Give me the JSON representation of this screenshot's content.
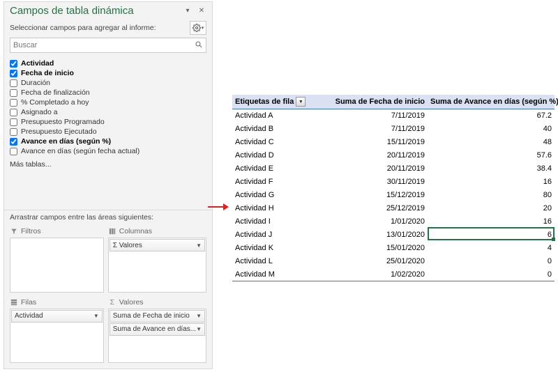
{
  "panel": {
    "title": "Campos de tabla dinámica",
    "subtitle": "Seleccionar campos para agregar al informe:",
    "search_placeholder": "Buscar",
    "more_tables": "Más tablas...",
    "drag_label": "Arrastrar campos entre las áreas siguientes:"
  },
  "fields": [
    {
      "label": "Actividad",
      "checked": true
    },
    {
      "label": "Fecha de inicio",
      "checked": true
    },
    {
      "label": "Duración",
      "checked": false
    },
    {
      "label": "Fecha de finalización",
      "checked": false
    },
    {
      "label": "% Completado a hoy",
      "checked": false
    },
    {
      "label": "Asignado a",
      "checked": false
    },
    {
      "label": "Presupuesto Programado",
      "checked": false
    },
    {
      "label": "Presupuesto Ejecutado",
      "checked": false
    },
    {
      "label": "Avance en días (según %)",
      "checked": true
    },
    {
      "label": "Avance en días (según fecha actual)",
      "checked": false
    }
  ],
  "areas": {
    "filtros": {
      "title": "Filtros",
      "items": []
    },
    "columnas": {
      "title": "Columnas",
      "items": [
        "Σ Valores"
      ]
    },
    "filas": {
      "title": "Filas",
      "items": [
        "Actividad"
      ]
    },
    "valores": {
      "title": "Valores",
      "items": [
        "Suma de Fecha de inicio",
        "Suma de Avance en días..."
      ]
    }
  },
  "pivot": {
    "headers": [
      "Etiquetas de fila",
      "Suma de Fecha de inicio",
      "Suma de Avance en días (según %)"
    ],
    "rows": [
      {
        "label": "Actividad A",
        "date": "7/11/2019",
        "val": "67.2"
      },
      {
        "label": "Actividad B",
        "date": "7/11/2019",
        "val": "40"
      },
      {
        "label": "Actividad C",
        "date": "15/11/2019",
        "val": "48"
      },
      {
        "label": "Actividad D",
        "date": "20/11/2019",
        "val": "57.6"
      },
      {
        "label": "Actividad E",
        "date": "20/11/2019",
        "val": "38.4"
      },
      {
        "label": "Actividad F",
        "date": "30/11/2019",
        "val": "16"
      },
      {
        "label": "Actividad G",
        "date": "15/12/2019",
        "val": "80"
      },
      {
        "label": "Actividad H",
        "date": "25/12/2019",
        "val": "20"
      },
      {
        "label": "Actividad I",
        "date": "1/01/2020",
        "val": "16"
      },
      {
        "label": "Actividad J",
        "date": "13/01/2020",
        "val": "6"
      },
      {
        "label": "Actividad K",
        "date": "15/01/2020",
        "val": "4"
      },
      {
        "label": "Actividad L",
        "date": "25/01/2020",
        "val": "0"
      },
      {
        "label": "Actividad M",
        "date": "1/02/2020",
        "val": "0"
      }
    ]
  },
  "chart_data": {
    "type": "table",
    "title": "Campos de tabla dinámica — tabla resumen",
    "headers": [
      "Etiquetas de fila",
      "Suma de Fecha de inicio",
      "Suma de Avance en días (según %)"
    ],
    "rows": [
      [
        "Actividad A",
        "7/11/2019",
        67.2
      ],
      [
        "Actividad B",
        "7/11/2019",
        40
      ],
      [
        "Actividad C",
        "15/11/2019",
        48
      ],
      [
        "Actividad D",
        "20/11/2019",
        57.6
      ],
      [
        "Actividad E",
        "20/11/2019",
        38.4
      ],
      [
        "Actividad F",
        "30/11/2019",
        16
      ],
      [
        "Actividad G",
        "15/12/2019",
        80
      ],
      [
        "Actividad H",
        "25/12/2019",
        20
      ],
      [
        "Actividad I",
        "1/01/2020",
        16
      ],
      [
        "Actividad J",
        "13/01/2020",
        6
      ],
      [
        "Actividad K",
        "15/01/2020",
        4
      ],
      [
        "Actividad L",
        "25/01/2020",
        0
      ],
      [
        "Actividad M",
        "1/02/2020",
        0
      ]
    ]
  }
}
